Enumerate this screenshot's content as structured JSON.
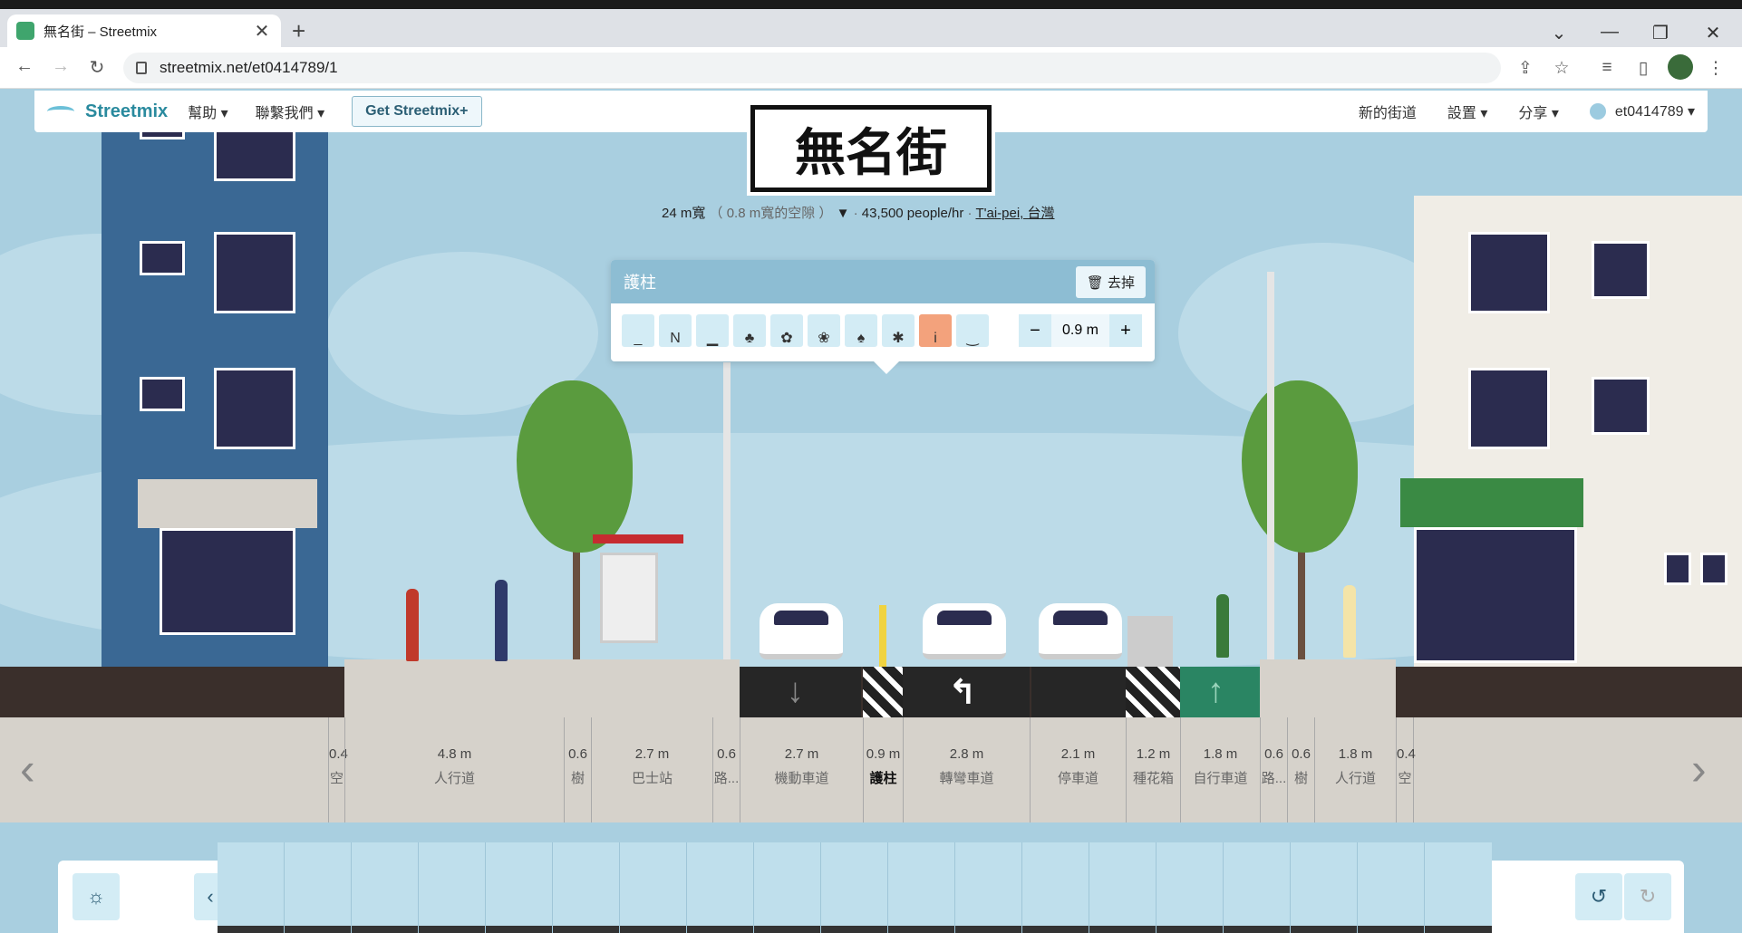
{
  "browser": {
    "tab_title": "無名街 – Streetmix",
    "url": "streetmix.net/et0414789/1",
    "new_tab": "+",
    "close_tab": "✕"
  },
  "menu": {
    "logo": "Streetmix",
    "help": "幫助 ▾",
    "contact": "聯繫我們 ▾",
    "get_plus": "Get Streetmix+",
    "new_street": "新的街道",
    "settings": "設置 ▾",
    "share": "分享 ▾",
    "user": "et0414789 ▾"
  },
  "street": {
    "name": "無名街",
    "width": "24 m寬",
    "remaining": "（ 0.8 m寬的空隙 ）",
    "capacity": "43,500 people/hr",
    "location": "T'ai-pei, 台灣"
  },
  "popup": {
    "title": "護柱",
    "remove": "去掉",
    "width_value": "0.9 m",
    "minus": "−",
    "plus": "+"
  },
  "segments": [
    {
      "width": "0.4",
      "name": "空"
    },
    {
      "width": "4.8 m",
      "name": "人行道"
    },
    {
      "width": "0.6",
      "name": "樹"
    },
    {
      "width": "2.7 m",
      "name": "巴士站"
    },
    {
      "width": "0.6",
      "name": "路..."
    },
    {
      "width": "2.7 m",
      "name": "機動車道"
    },
    {
      "width": "0.9 m",
      "name": "護柱"
    },
    {
      "width": "2.8 m",
      "name": "轉彎車道"
    },
    {
      "width": "2.1 m",
      "name": "停車道"
    },
    {
      "width": "1.2 m",
      "name": "種花箱"
    },
    {
      "width": "1.8 m",
      "name": "自行車道"
    },
    {
      "width": "0.6",
      "name": "路..."
    },
    {
      "width": "0.6",
      "name": "樹"
    },
    {
      "width": "1.8 m",
      "name": "人行道"
    },
    {
      "width": "0.4",
      "name": "空"
    }
  ],
  "colors": {
    "sky": "#a9cfe0",
    "road": "#262626",
    "bike_lane": "#2a8563",
    "selected_variant": "#f3a27c",
    "brand": "#2a8a9e"
  }
}
